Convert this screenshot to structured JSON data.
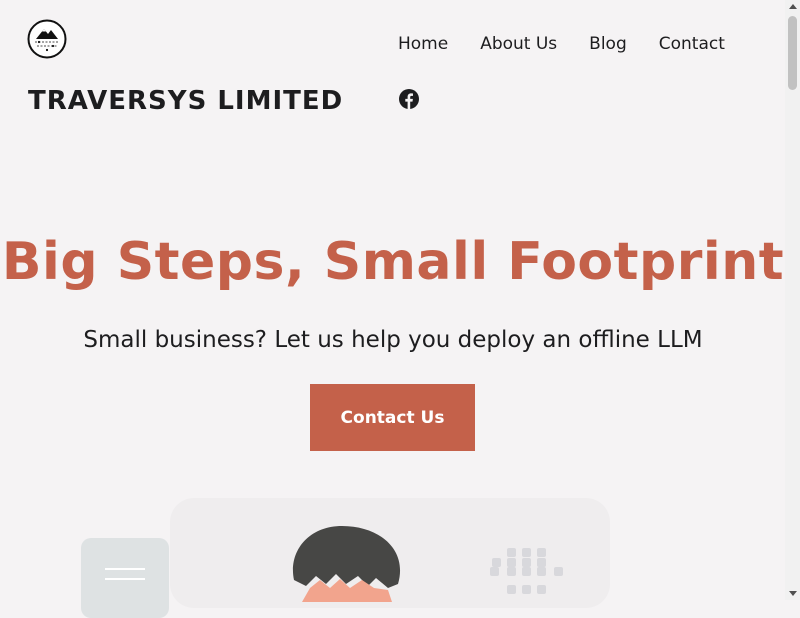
{
  "header": {
    "site_title": "TRAVERSYS LIMITED",
    "logo_icon": "mountain-circuit-logo-icon"
  },
  "nav": {
    "items": [
      {
        "label": "Home"
      },
      {
        "label": "About Us"
      },
      {
        "label": "Blog"
      },
      {
        "label": "Contact"
      }
    ],
    "social_icon": "facebook-icon"
  },
  "hero": {
    "title": "Big Steps, Small Footprint",
    "subtitle": "Small business? Let us help you deploy an offline LLM",
    "cta_label": "Contact Us"
  },
  "colors": {
    "accent": "#c4614a",
    "background": "#f5f3f4",
    "text": "#1d1d1f"
  }
}
